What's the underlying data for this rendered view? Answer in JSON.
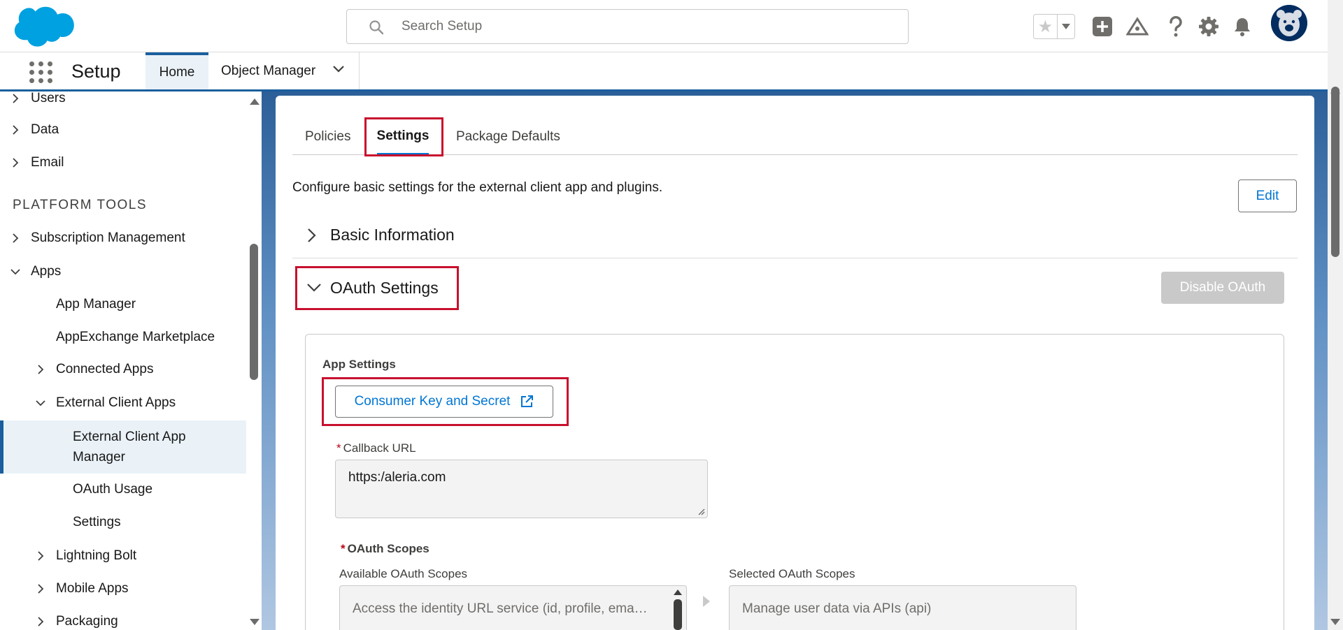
{
  "header": {
    "search_placeholder": "Search Setup",
    "icons": [
      "favorites-star-icon",
      "favorites-dropdown-icon",
      "global-actions-icon",
      "trailhead-icon",
      "help-icon",
      "setup-gear-icon",
      "notifications-bell-icon",
      "user-avatar"
    ]
  },
  "context_bar": {
    "app_name": "Setup",
    "tabs": [
      {
        "label": "Home",
        "active": true
      },
      {
        "label": "Object Manager",
        "active": false
      }
    ]
  },
  "sidebar": {
    "items": [
      {
        "label": "Users",
        "level": 0,
        "expanded": false
      },
      {
        "label": "Data",
        "level": 0,
        "expanded": false
      },
      {
        "label": "Email",
        "level": 0,
        "expanded": false
      },
      {
        "label": "Subscription Management",
        "level": 0,
        "expanded": false
      },
      {
        "label": "Apps",
        "level": 0,
        "expanded": true
      },
      {
        "label": "App Manager",
        "level": 1
      },
      {
        "label": "AppExchange Marketplace",
        "level": 1
      },
      {
        "label": "Connected Apps",
        "level": 1,
        "expanded": false
      },
      {
        "label": "External Client Apps",
        "level": 1,
        "expanded": true
      },
      {
        "label": "External Client App Manager",
        "level": 2,
        "selected": true
      },
      {
        "label": "OAuth Usage",
        "level": 2
      },
      {
        "label": "Settings",
        "level": 2
      },
      {
        "label": "Lightning Bolt",
        "level": 1,
        "expanded": false
      },
      {
        "label": "Mobile Apps",
        "level": 1,
        "expanded": false
      },
      {
        "label": "Packaging",
        "level": 1,
        "expanded": false
      }
    ],
    "section_heading": "PLATFORM TOOLS"
  },
  "main": {
    "tabs": [
      {
        "label": "Policies",
        "active": false
      },
      {
        "label": "Settings",
        "active": true
      },
      {
        "label": "Package Defaults",
        "active": false
      }
    ],
    "description": "Configure basic settings for the external client app and plugins.",
    "edit_label": "Edit",
    "sections": {
      "basic_info": {
        "title": "Basic Information",
        "expanded": false
      },
      "oauth": {
        "title": "OAuth Settings",
        "expanded": true
      }
    },
    "disable_oauth_label": "Disable OAuth",
    "app_settings": {
      "heading": "App Settings",
      "consumer_button_label": "Consumer Key and Secret",
      "callback_label": "Callback URL",
      "callback_value": "https:/aleria.com",
      "required_marker": "*",
      "scopes_heading": "OAuth Scopes",
      "available_label": "Available OAuth Scopes",
      "selected_label": "Selected OAuth Scopes",
      "available_first": "Access the identity URL service (id, profile, ema…",
      "selected_first": "Manage user data via APIs (api)"
    }
  },
  "colors": {
    "brand_blue": "#0176d3",
    "highlight_red": "#c8102e",
    "nav_selected_bg": "#eaf2f8",
    "salesforce_cloud": "#00a1e0"
  }
}
